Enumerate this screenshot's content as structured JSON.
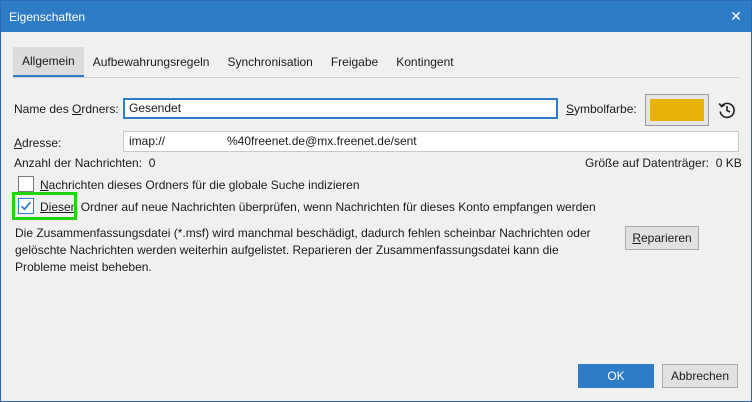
{
  "window": {
    "title": "Eigenschaften",
    "close_glyph": "✕"
  },
  "tabs": [
    {
      "label": "Allgemein",
      "active": true
    },
    {
      "label": "Aufbewahrungsregeln",
      "active": false
    },
    {
      "label": "Synchronisation",
      "active": false
    },
    {
      "label": "Freigabe",
      "active": false
    },
    {
      "label": "Kontingent",
      "active": false
    }
  ],
  "folder_name": {
    "label_prefix": "Name des ",
    "label_accel": "O",
    "label_suffix": "rdners:",
    "value": "Gesendet"
  },
  "symbol_color": {
    "label_accel": "S",
    "label_suffix": "ymbolfarbe:",
    "color": "#e8b206",
    "reset_icon": "history-reset-icon"
  },
  "address": {
    "label_accel": "A",
    "label_suffix": "dresse:",
    "value_prefix": "imap://",
    "value_suffix": "%40freenet.de@mx.freenet.de/sent"
  },
  "message_count": {
    "label": "Anzahl der Nachrichten:",
    "value": "0"
  },
  "disk_size": {
    "label": "Größe auf Datenträger:",
    "value": "0 KB"
  },
  "checkbox_index": {
    "accel": "N",
    "label": "achrichten dieses Ordners für die globale Suche indizieren",
    "checked": false
  },
  "checkbox_check": {
    "accel": "D",
    "label_highlighted": "iesen",
    "label_rest": " Ordner auf neue Nachrichten überprüfen, wenn Nachrichten für dieses Konto empfangen werden",
    "checked": true
  },
  "description": "Die Zusammenfassungsdatei (*.msf) wird manchmal beschädigt, dadurch fehlen scheinbar Nachrichten oder gelöschte Nachrichten werden weiterhin aufgelistet. Reparieren der Zusammenfassungsdatei kann die Probleme meist beheben.",
  "repair_button": {
    "accel": "R",
    "label": "eparieren"
  },
  "ok_button": "OK",
  "cancel_button": "Abbrechen",
  "colors": {
    "accent": "#2e7bc6",
    "highlight_box": "#22d40f"
  }
}
